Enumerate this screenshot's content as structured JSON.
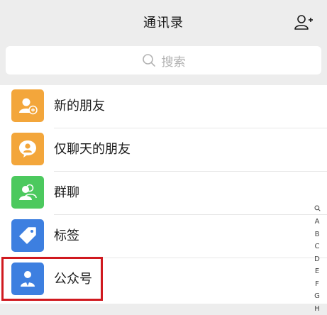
{
  "header": {
    "title": "通讯录",
    "add_icon": "add-contact-icon"
  },
  "search": {
    "placeholder": "搜索",
    "icon": "search-icon"
  },
  "items": [
    {
      "label": "新的朋友",
      "icon": "new-friend-icon",
      "color": "#f3a63b"
    },
    {
      "label": "仅聊天的朋友",
      "icon": "chat-only-friend-icon",
      "color": "#f3a63b"
    },
    {
      "label": "群聊",
      "icon": "group-chat-icon",
      "color": "#4cc95e"
    },
    {
      "label": "标签",
      "icon": "tag-icon",
      "color": "#3d7fe0"
    },
    {
      "label": "公众号",
      "icon": "official-account-icon",
      "color": "#3d7fe0"
    }
  ],
  "highlight_color": "#d0191f",
  "alphabet_index": {
    "search_icon": "search-icon",
    "letters": [
      "A",
      "B",
      "C",
      "D",
      "E",
      "F",
      "G",
      "H"
    ]
  }
}
